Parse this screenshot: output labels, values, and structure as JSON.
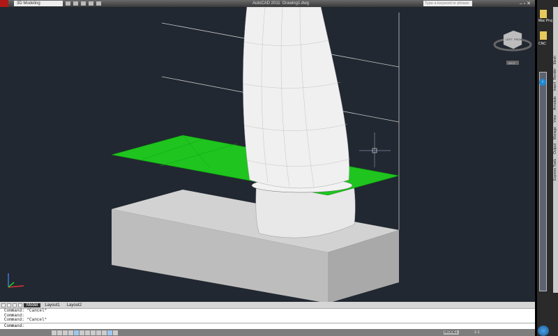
{
  "titlebar": {
    "workspace": "3D Modeling",
    "app_title": "AutoCAD 2011",
    "drawing": "Drawing1.dwg",
    "search_placeholder": "Type a keyword or phrase",
    "win_buttons": "– ▫ ✕"
  },
  "viewcube": {
    "left": "LEFT",
    "front": "FRONT",
    "wcs": "WCS"
  },
  "layout_tabs": [
    "Model",
    "Layout1",
    "Layout2"
  ],
  "command_history": [
    "Command: *Cancel*",
    "Command:",
    "Command: *Cancel*"
  ],
  "command_prompt": "Command:",
  "status": {
    "model": "MODEL",
    "scale": "1:1"
  },
  "desktop": {
    "icons": [
      "Mac Proj",
      "CNC"
    ]
  },
  "ribbon_tabs": [
    "Mesh",
    "Render",
    "Insert",
    "Annotate",
    "View",
    "Manage",
    "Output",
    "Express Tools"
  ],
  "colors": {
    "viewport": "#222831",
    "plane": "#1fc41f",
    "box": "#c4c4c4"
  }
}
